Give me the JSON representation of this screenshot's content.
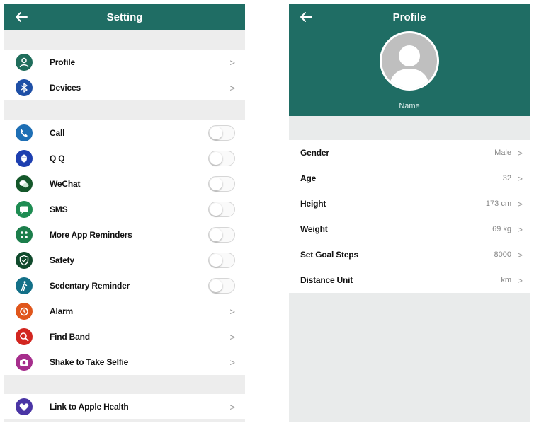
{
  "theme": {
    "header_color": "#1f6d64"
  },
  "settings": {
    "title": "Setting",
    "chevron": ">",
    "sections": [
      [
        {
          "label": "Profile",
          "icon": "person-icon",
          "color": "#1f6d5b",
          "control": "chevron"
        },
        {
          "label": "Devices",
          "icon": "bluetooth-icon",
          "color": "#1e4fa6",
          "control": "chevron"
        }
      ],
      [
        {
          "label": "Call",
          "icon": "phone-icon",
          "color": "#1e6fb5",
          "control": "toggle"
        },
        {
          "label": "Q Q",
          "icon": "qq-icon",
          "color": "#1d3fb0",
          "control": "toggle"
        },
        {
          "label": "WeChat",
          "icon": "wechat-icon",
          "color": "#14572a",
          "control": "toggle"
        },
        {
          "label": "SMS",
          "icon": "sms-icon",
          "color": "#1e8c52",
          "control": "toggle"
        },
        {
          "label": "More App Reminders",
          "icon": "apps-icon",
          "color": "#1c7e4b",
          "control": "toggle"
        },
        {
          "label": "Safety",
          "icon": "shield-icon",
          "color": "#0f4a2c",
          "control": "toggle"
        },
        {
          "label": "Sedentary Reminder",
          "icon": "walking-icon",
          "color": "#137088",
          "control": "toggle"
        },
        {
          "label": "Alarm",
          "icon": "alarm-icon",
          "color": "#e0561c",
          "control": "chevron"
        },
        {
          "label": "Find Band",
          "icon": "search-icon",
          "color": "#d22620",
          "control": "chevron"
        },
        {
          "label": "Shake to Take Selfie",
          "icon": "camera-icon",
          "color": "#a62e8c",
          "control": "chevron"
        }
      ],
      [
        {
          "label": "Link to Apple Health",
          "icon": "heart-icon",
          "color": "#4a35a5",
          "control": "chevron"
        }
      ]
    ]
  },
  "profile": {
    "title": "Profile",
    "name": "Name",
    "chevron": ">",
    "fields": [
      {
        "label": "Gender",
        "value": "Male"
      },
      {
        "label": "Age",
        "value": "32"
      },
      {
        "label": "Height",
        "value": "173 cm"
      },
      {
        "label": "Weight",
        "value": "69 kg"
      },
      {
        "label": "Set Goal Steps",
        "value": "8000"
      },
      {
        "label": "Distance Unit",
        "value": "km"
      }
    ]
  }
}
